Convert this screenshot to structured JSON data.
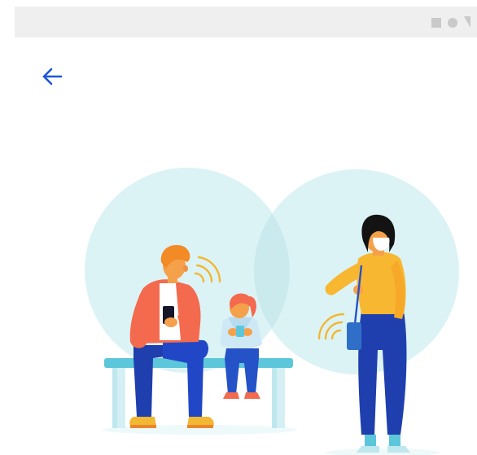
{
  "app": {
    "screen": "exposure-notification-intro"
  },
  "status_bar": {
    "icons": [
      "square-icon",
      "circle-icon",
      "triangle-icon"
    ]
  },
  "toolbar": {
    "back_icon": "arrow-left-icon",
    "accent_color": "#1a56db"
  },
  "illustration": {
    "subject": "people-nearby-phones-exchanging-signals",
    "circle_color": "#dcf3f6"
  }
}
